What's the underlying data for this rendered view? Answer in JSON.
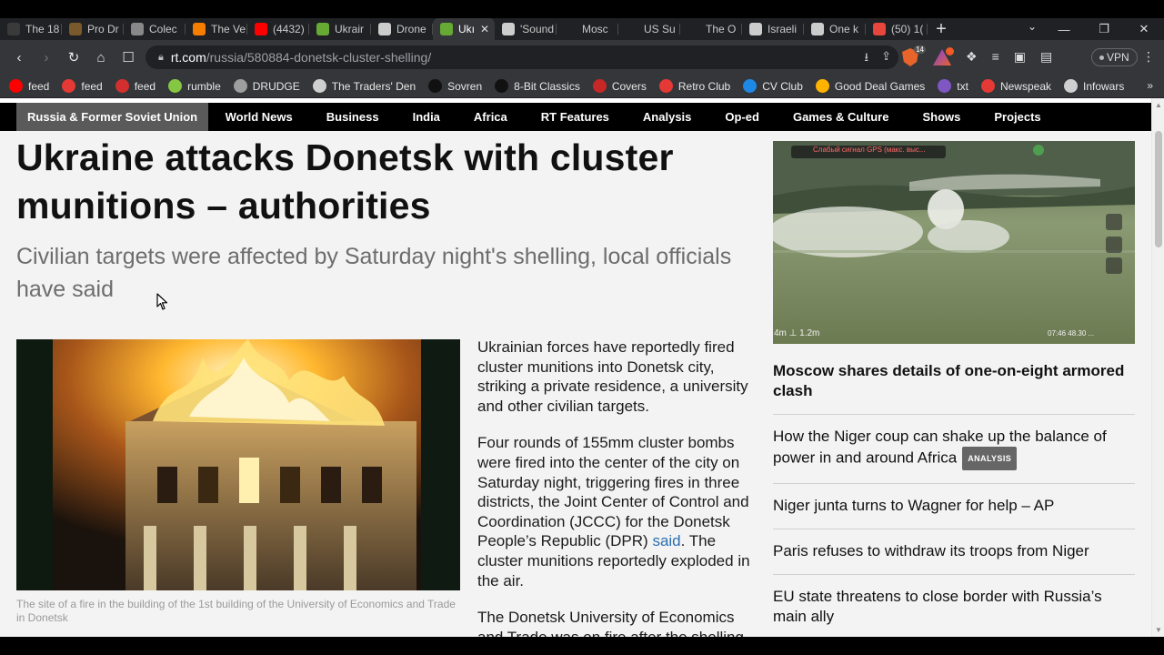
{
  "browser": {
    "tabs": [
      {
        "title": "The 18",
        "favicon_color": "#3a3a3a"
      },
      {
        "title": "Pro Dr",
        "favicon_color": "#7a5a2a"
      },
      {
        "title": "Colec",
        "favicon_color": "#888888"
      },
      {
        "title": "The Ve",
        "favicon_color": "#f57d00"
      },
      {
        "title": "(4432)",
        "favicon_color": "#ff0000"
      },
      {
        "title": "Ukrair",
        "favicon_color": "#66aa33"
      },
      {
        "title": "Drone",
        "favicon_color": "#cccccc"
      },
      {
        "title": "Ukı",
        "favicon_color": "#66aa33"
      },
      {
        "title": "'Sound",
        "favicon_color": "#cccccc"
      },
      {
        "title": "Mosc",
        "favicon_color": "#202124"
      },
      {
        "title": "US Su",
        "favicon_color": "#202124"
      },
      {
        "title": "The O",
        "favicon_color": "#202124"
      },
      {
        "title": "Israeli",
        "favicon_color": "#cccccc"
      },
      {
        "title": "One k",
        "favicon_color": "#cccccc"
      },
      {
        "title": "(50) 1(",
        "favicon_color": "#e8453c"
      }
    ],
    "active_tab_index": 7,
    "new_tab_label": "+",
    "tab_list_icon": "⌄",
    "window_controls": [
      "—",
      "❐",
      "✕"
    ],
    "url_host": "rt.com",
    "url_path": "/russia/580884-donetsk-cluster-shelling/",
    "brave_shield_count": "14",
    "vpn_label": "VPN",
    "bookmarks": [
      {
        "label": "feed",
        "color": "#ff0000"
      },
      {
        "label": "feed",
        "color": "#e53935"
      },
      {
        "label": "feed",
        "color": "#d32f2f"
      },
      {
        "label": "rumble",
        "color": "#85c742"
      },
      {
        "label": "DRUDGE",
        "color": "#9e9e9e"
      },
      {
        "label": "The Traders' Den",
        "color": "#cfcfcf"
      },
      {
        "label": "Sovren",
        "color": "#111111"
      },
      {
        "label": "8-Bit Classics",
        "color": "#111111"
      },
      {
        "label": "Covers",
        "color": "#c62828"
      },
      {
        "label": "Retro Club",
        "color": "#e53935"
      },
      {
        "label": "CV Club",
        "color": "#1e88e5"
      },
      {
        "label": "Good Deal Games",
        "color": "#ffb300"
      },
      {
        "label": "txt",
        "color": "#7e57c2"
      },
      {
        "label": "Newspeak",
        "color": "#e53935"
      },
      {
        "label": "Infowars",
        "color": "#cfcfcf"
      }
    ],
    "bookmarks_more": "»"
  },
  "site": {
    "nav": [
      {
        "label": "Russia & Former Soviet Union",
        "active": true
      },
      {
        "label": "World News"
      },
      {
        "label": "Business"
      },
      {
        "label": "India"
      },
      {
        "label": "Africa"
      },
      {
        "label": "RT Features"
      },
      {
        "label": "Analysis"
      },
      {
        "label": "Op-ed"
      },
      {
        "label": "Games & Culture"
      },
      {
        "label": "Shows"
      },
      {
        "label": "Projects"
      }
    ]
  },
  "article": {
    "headline": "Ukraine attacks Donetsk with cluster munitions – authorities",
    "standfirst": "Civilian targets were affected by Saturday night's shelling, local officials have said",
    "image_caption": "The site of a fire in the building of the 1st building of the University of Economics and Trade in Donetsk",
    "para1": "Ukrainian forces have reportedly fired cluster munitions into Donetsk city, striking a private residence, a university and other civilian targets.",
    "para2_before": "Four rounds of 155mm cluster bombs were fired into the center of the city on Saturday night, triggering fires in three districts, the Joint Center of Control and Coordination (JCCC) for the Donetsk People’s Republic (DPR) ",
    "para2_link": "said",
    "para2_after": ". The cluster munitions reportedly exploded in the air.",
    "para3": "The Donetsk University of Economics and Trade was on fire after the shelling"
  },
  "sidebar": {
    "video_overlay_text": "Слабый сигнал GPS (макс. выс...",
    "video_readout_left": "4m  ⊥ 1.2m",
    "video_readout_right": "07:46  48.30  ...",
    "lead_title": "Moscow shares details of one-on-eight armored clash",
    "items": [
      {
        "title": "How the Niger coup can shake up the balance of power in and around Africa",
        "tag": "ANALYSIS"
      },
      {
        "title": "Niger junta turns to Wagner for help – AP"
      },
      {
        "title": "Paris refuses to withdraw its troops from Niger"
      },
      {
        "title": "EU state threatens to close border with Russia’s main ally"
      }
    ]
  }
}
